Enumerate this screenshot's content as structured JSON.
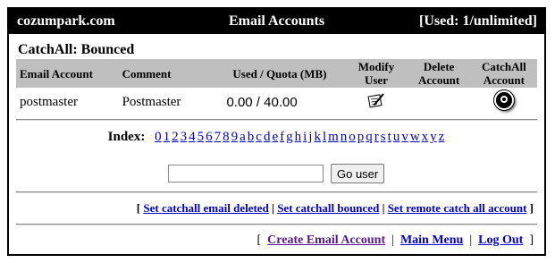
{
  "header": {
    "domain": "cozumpark.com",
    "title": "Email Accounts",
    "usage": "[Used: 1/unlimited]"
  },
  "section_title": "CatchAll: Bounced",
  "table": {
    "columns": {
      "email": "Email Account",
      "comment": "Comment",
      "used": "Used / Quota (MB)",
      "modify": "Modify User",
      "delete": "Delete Account",
      "catchall": "CatchAll Account"
    },
    "rows": [
      {
        "email": "postmaster",
        "comment": "Postmaster",
        "used": "0.00 / 40.00",
        "modify_icon": "edit-note-icon",
        "catchall_icon": "radio-selected-icon"
      }
    ]
  },
  "index": {
    "label": "Index:",
    "letters": [
      "0",
      "1",
      "2",
      "3",
      "4",
      "5",
      "6",
      "7",
      "8",
      "9",
      "a",
      "b",
      "c",
      "d",
      "e",
      "f",
      "g",
      "h",
      "i",
      "j",
      "k",
      "l",
      "m",
      "n",
      "o",
      "p",
      "q",
      "r",
      "s",
      "t",
      "u",
      "v",
      "w",
      "x",
      "y",
      "z"
    ]
  },
  "go_user": {
    "input_value": "",
    "button_label": "Go user"
  },
  "catchall_links": {
    "open_bracket": "[",
    "deleted": "Set catchall email deleted",
    "sep1": "|",
    "bounced": "Set catchall bounced",
    "sep2": "|",
    "remote": "Set remote catch all account",
    "close_bracket": "]"
  },
  "nav_links": {
    "open_bracket": "[",
    "create": "Create Email Account",
    "sep1": "|",
    "main_menu": "Main Menu",
    "sep2": "|",
    "logout": "Log Out",
    "close_bracket": "]"
  },
  "colors": {
    "header_bg": "#000000",
    "table_header_bg": "#bfbfbf",
    "link": "#0000cc",
    "visited_link": "#551a8b"
  }
}
